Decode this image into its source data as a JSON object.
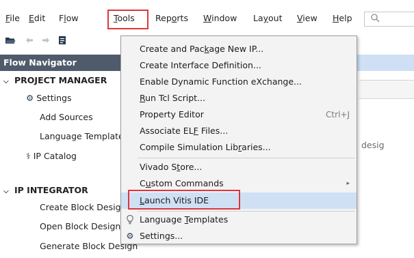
{
  "menubar": {
    "items": [
      {
        "pre": "",
        "ul": "F",
        "post": "ile"
      },
      {
        "pre": "",
        "ul": "E",
        "post": "dit"
      },
      {
        "pre": "F",
        "ul": "l",
        "post": "ow"
      },
      {
        "pre": "",
        "ul": "T",
        "post": "ools"
      },
      {
        "pre": "Rep",
        "ul": "o",
        "post": "rts"
      },
      {
        "pre": "",
        "ul": "W",
        "post": "indow"
      },
      {
        "pre": "La",
        "ul": "y",
        "post": "out"
      },
      {
        "pre": "",
        "ul": "V",
        "post": "iew"
      },
      {
        "pre": "",
        "ul": "H",
        "post": "elp"
      }
    ]
  },
  "nav": {
    "header": "Flow Navigator",
    "project_manager": "PROJECT MANAGER",
    "settings": "Settings",
    "add_sources": "Add Sources",
    "language_templates": "Language Templates",
    "ip_catalog": "IP Catalog",
    "ip_integrator": "IP INTEGRATOR",
    "create_block_design": "Create Block Design",
    "open_block_design": "Open Block Design",
    "generate_block_design": "Generate Block Design"
  },
  "background": {
    "desig": "desig"
  },
  "tools_menu": {
    "items": [
      {
        "id": "create-package-ip",
        "pre": "Create and Pac",
        "ul": "k",
        "post": "age New IP...",
        "shortcut": ""
      },
      {
        "id": "create-interface",
        "pre": "Create Interface Definition...",
        "ul": "",
        "post": "",
        "shortcut": ""
      },
      {
        "id": "enable-dfx",
        "pre": "Enable Dynamic Function eXchange...",
        "ul": "",
        "post": "",
        "shortcut": ""
      },
      {
        "id": "run-tcl",
        "pre": "",
        "ul": "R",
        "post": "un Tcl Script...",
        "shortcut": ""
      },
      {
        "id": "property-editor",
        "pre": "Property Editor",
        "ul": "",
        "post": "",
        "shortcut": "Ctrl+J"
      },
      {
        "id": "associate-elf",
        "pre": "Associate EL",
        "ul": "F",
        "post": " Files...",
        "shortcut": ""
      },
      {
        "id": "compile-sim-libs",
        "pre": "Compile Simulation Lib",
        "ul": "r",
        "post": "aries...",
        "shortcut": ""
      },
      {
        "id": "vivado-store",
        "pre": "Vivado S",
        "ul": "t",
        "post": "ore...",
        "shortcut": ""
      },
      {
        "id": "custom-commands",
        "pre": "C",
        "ul": "u",
        "post": "stom Commands",
        "shortcut": ""
      },
      {
        "id": "launch-vitis",
        "pre": "",
        "ul": "L",
        "post": "aunch Vitis IDE",
        "shortcut": ""
      },
      {
        "id": "language-templates",
        "pre": "Language ",
        "ul": "T",
        "post": "emplates",
        "shortcut": ""
      },
      {
        "id": "settings",
        "pre": "Settings...",
        "ul": "",
        "post": "",
        "shortcut": ""
      }
    ]
  },
  "icons": {
    "open_project": "folder-open-icon",
    "undo": "undo-icon",
    "redo": "redo-icon",
    "document": "document-icon",
    "search": "search-icon",
    "gear": "gear-icon",
    "ip_catalog": "plug-icon",
    "lightbulb": "lightbulb-icon",
    "submenu": "chevron-right-icon"
  },
  "colors": {
    "highlight": "#cfe0f4",
    "nav_header": "#4f5b6b",
    "annotation": "#e0343a"
  }
}
